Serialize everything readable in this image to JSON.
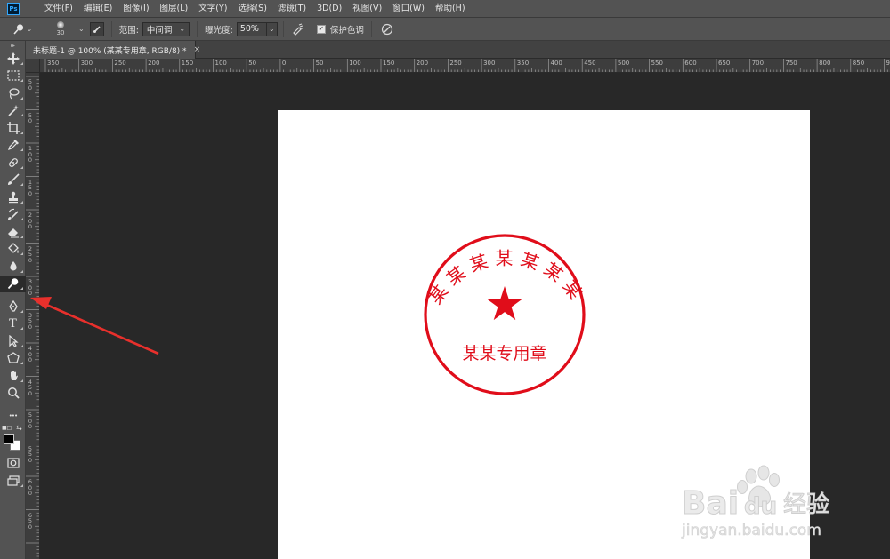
{
  "app": {
    "logo_text": "Ps"
  },
  "menu": {
    "items": [
      "文件(F)",
      "编辑(E)",
      "图像(I)",
      "图层(L)",
      "文字(Y)",
      "选择(S)",
      "滤镜(T)",
      "3D(D)",
      "视图(V)",
      "窗口(W)",
      "帮助(H)"
    ]
  },
  "options": {
    "tool_icon": "dodge-tool-icon",
    "brush_size": "30",
    "range_label": "范围:",
    "range_value": "中间调",
    "exposure_label": "曝光度:",
    "exposure_value": "50%",
    "protect_tones_label": "保护色调",
    "protect_tones_checked": true
  },
  "document": {
    "tab_title": "未标题-1 @ 100% (某某专用章, RGB/8) *",
    "close_glyph": "×"
  },
  "ruler": {
    "h_labels": [
      "350",
      "300",
      "250",
      "200",
      "150",
      "100",
      "50",
      "0",
      "50",
      "100",
      "150",
      "200",
      "250",
      "300",
      "350",
      "400",
      "450",
      "500",
      "550",
      "600",
      "650",
      "700",
      "750",
      "800",
      "850",
      "900"
    ],
    "v_labels": [
      "5 0",
      "5 0",
      "1 0 0",
      "1 5 0",
      "2 0 0",
      "2 5 0",
      "3 0 0",
      "3 5 0",
      "4 0 0",
      "4 5 0",
      "5 0 0",
      "5 5 0",
      "6 0 0",
      "6 5 0"
    ]
  },
  "stamp": {
    "color": "#e00d1a",
    "arc_text": "某某某某某某某",
    "bottom_text": "某某专用章",
    "center_symbol": "star"
  },
  "watermark": {
    "brand": "Bai",
    "brand2": "du",
    "suffix": "经验",
    "url": "jingyan.baidu.com"
  },
  "tools": [
    "move-tool-icon",
    "marquee-tool-icon",
    "lasso-tool-icon",
    "magic-wand-tool-icon",
    "crop-tool-icon",
    "eyedropper-tool-icon",
    "healing-brush-tool-icon",
    "brush-tool-icon",
    "clone-stamp-tool-icon",
    "history-brush-tool-icon",
    "eraser-tool-icon",
    "paint-bucket-tool-icon",
    "blur-tool-icon",
    "dodge-tool-icon",
    "pen-tool-icon",
    "type-tool-icon",
    "path-selection-tool-icon",
    "shape-tool-icon",
    "hand-tool-icon",
    "zoom-tool-icon",
    "edit-toolbar-icon"
  ],
  "type_tool_glyph": "T",
  "more_glyph": "•••"
}
